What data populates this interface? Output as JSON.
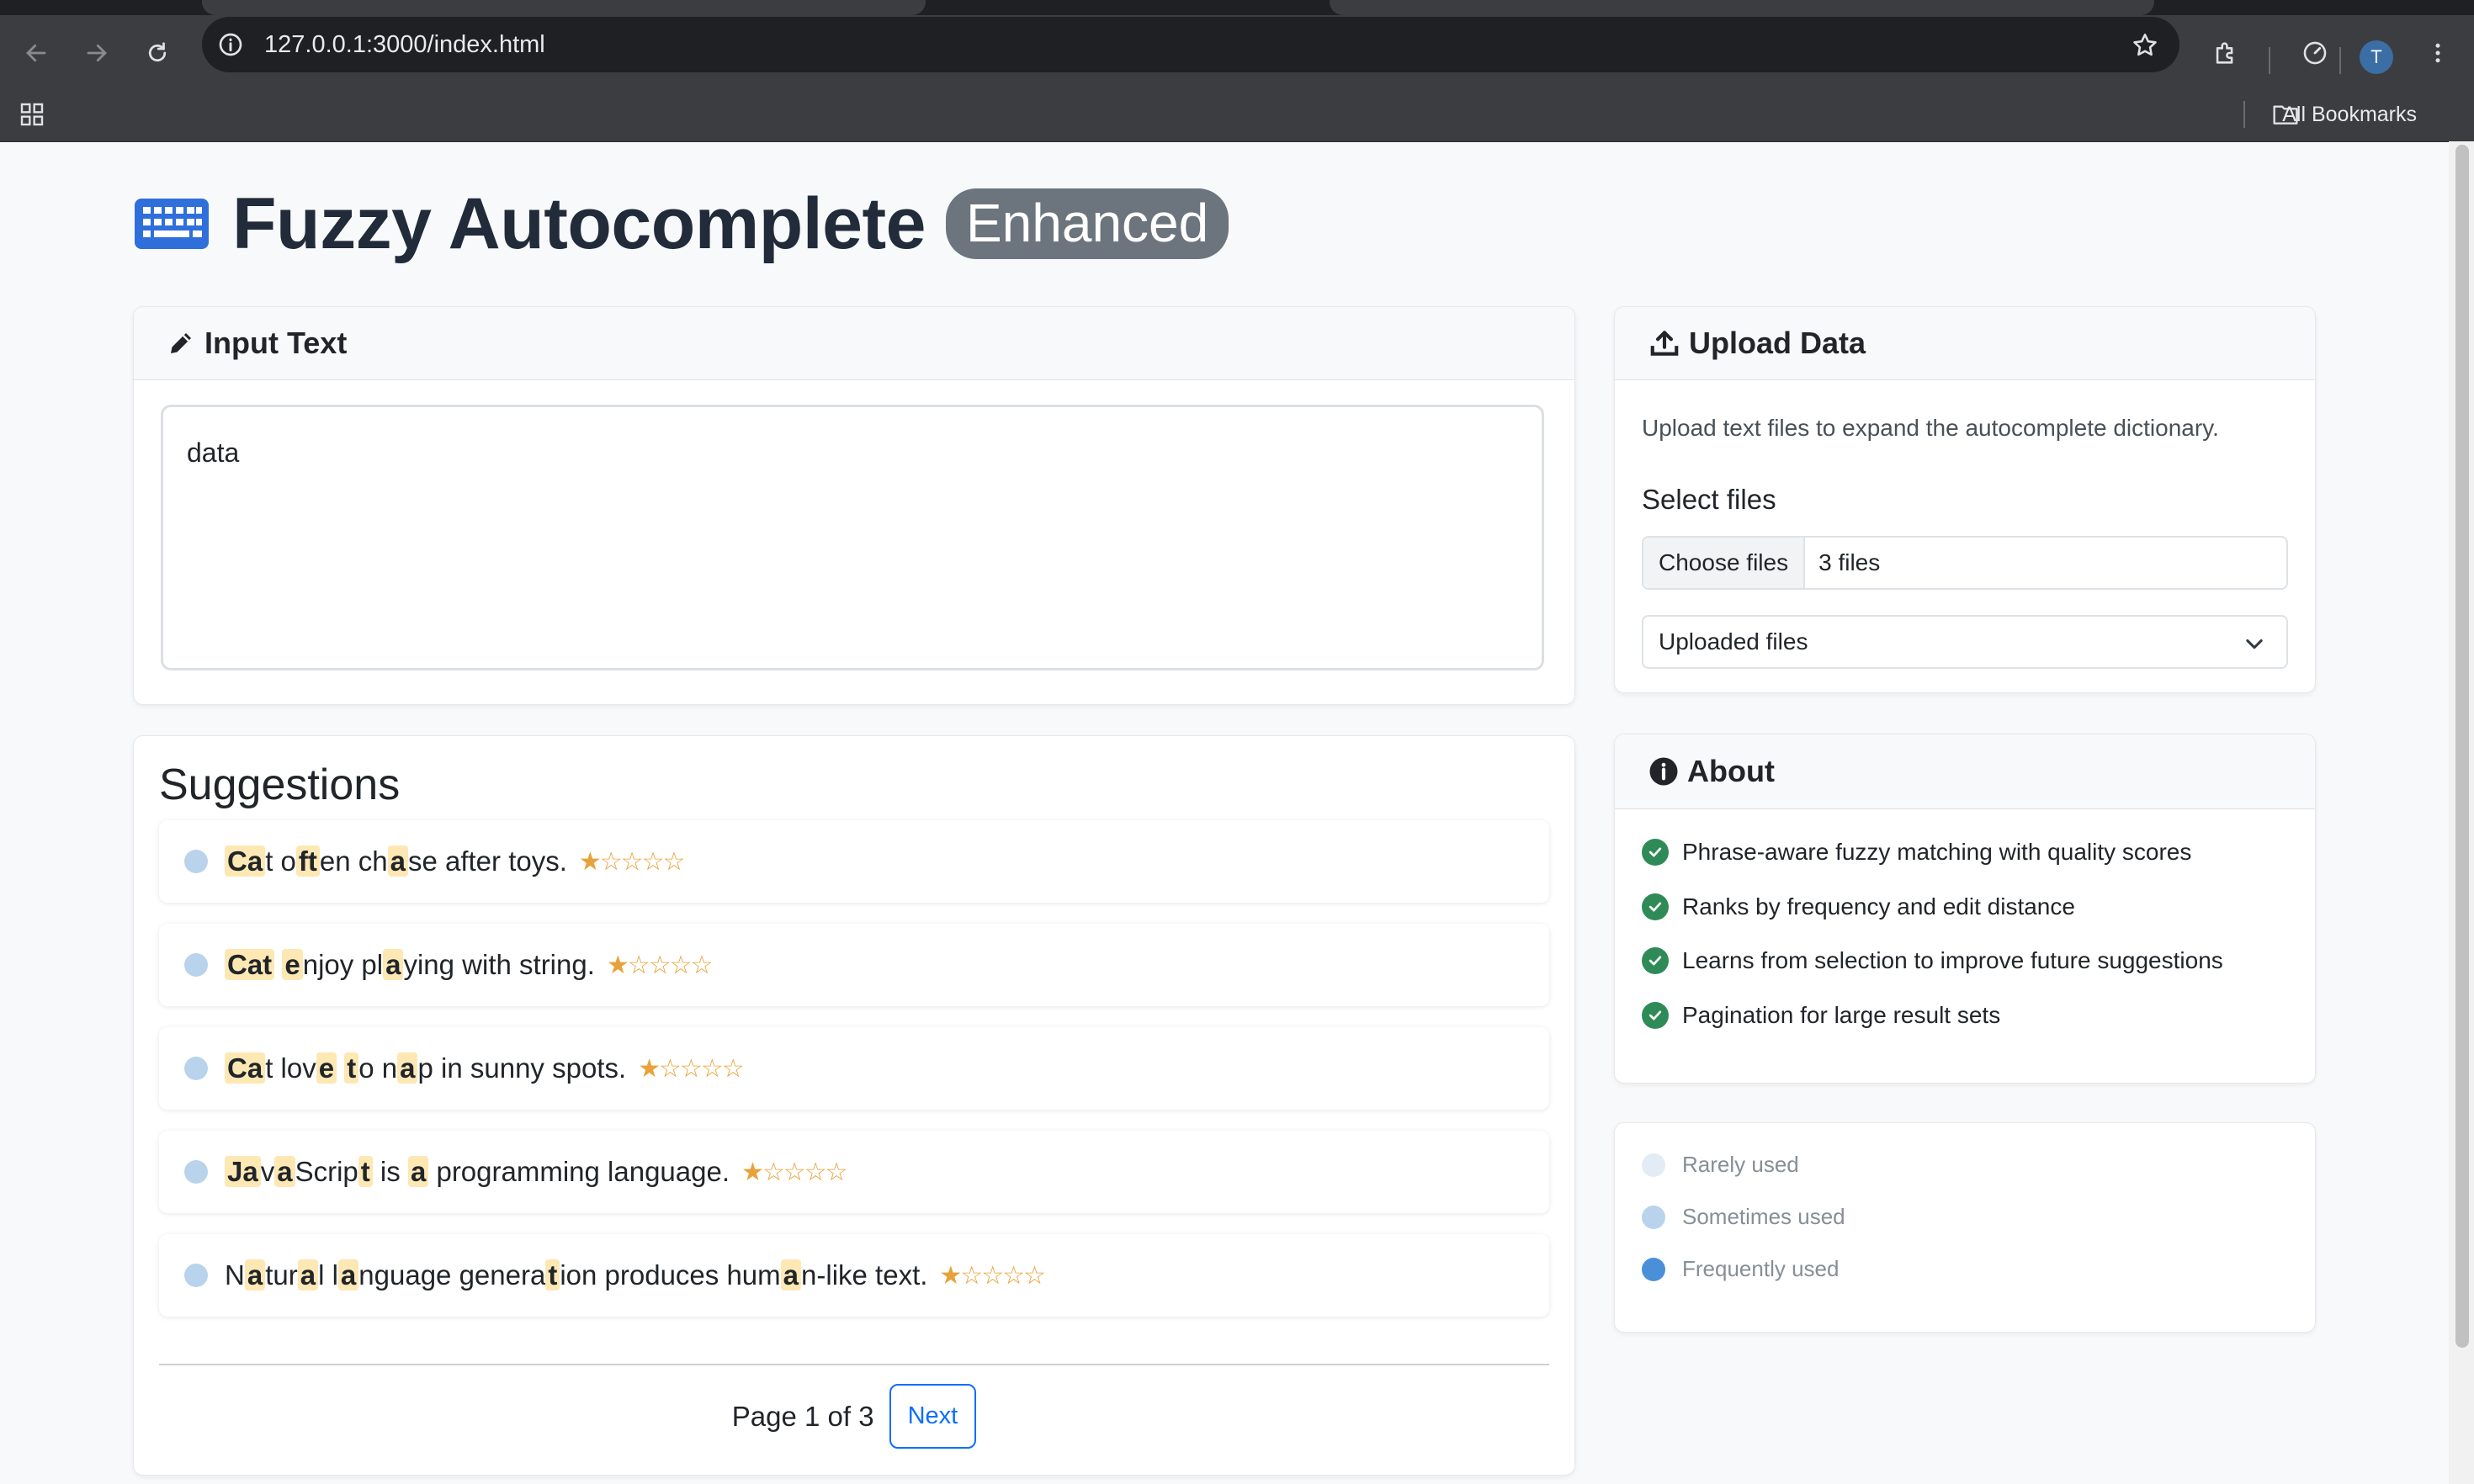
{
  "browser": {
    "url": "127.0.0.1:3000/index.html",
    "all_bookmarks": "All Bookmarks",
    "profile_initial": "T"
  },
  "page": {
    "title": "Fuzzy Autocomplete",
    "badge": "Enhanced"
  },
  "input_card": {
    "header": "Input Text",
    "value": "data"
  },
  "suggestions": {
    "title": "Suggestions",
    "items": [
      {
        "segments": [
          [
            "Ca",
            1
          ],
          [
            "t o",
            0
          ],
          [
            "ft",
            1
          ],
          [
            "en ch",
            0
          ],
          [
            "a",
            1
          ],
          [
            "se after toys.",
            0
          ]
        ],
        "stars": "★☆☆☆☆"
      },
      {
        "segments": [
          [
            "Cat",
            1
          ],
          [
            " ",
            0
          ],
          [
            "e",
            1
          ],
          [
            "njoy pl",
            0
          ],
          [
            "a",
            1
          ],
          [
            "ying with string.",
            0
          ]
        ],
        "stars": "★☆☆☆☆"
      },
      {
        "segments": [
          [
            "Ca",
            1
          ],
          [
            "t lov",
            0
          ],
          [
            "e",
            1
          ],
          [
            " ",
            0
          ],
          [
            "t",
            1
          ],
          [
            "o n",
            0
          ],
          [
            "a",
            1
          ],
          [
            "p in sunny spots.",
            0
          ]
        ],
        "stars": "★☆☆☆☆"
      },
      {
        "segments": [
          [
            "Ja",
            1
          ],
          [
            "v",
            0
          ],
          [
            "a",
            1
          ],
          [
            "Scrip",
            0
          ],
          [
            "t",
            1
          ],
          [
            " is ",
            0
          ],
          [
            "a",
            1
          ],
          [
            " programming language.",
            0
          ]
        ],
        "stars": "★☆☆☆☆"
      },
      {
        "segments": [
          [
            "N",
            0
          ],
          [
            "a",
            1
          ],
          [
            "tur",
            0
          ],
          [
            "a",
            1
          ],
          [
            "l l",
            0
          ],
          [
            "a",
            1
          ],
          [
            "nguage genera",
            0
          ],
          [
            "t",
            1
          ],
          [
            "ion produces hum",
            0
          ],
          [
            "a",
            1
          ],
          [
            "n-like text.",
            0
          ]
        ],
        "stars": "★☆☆☆☆"
      }
    ],
    "page_info": "Page 1 of 3",
    "next_label": "Next"
  },
  "upload": {
    "header": "Upload Data",
    "description": "Upload text files to expand the autocomplete dictionary.",
    "select_label": "Select files",
    "choose_button": "Choose files",
    "file_status": "3 files",
    "dropdown_value": "Uploaded files"
  },
  "about": {
    "header": "About",
    "features": [
      "Phrase-aware fuzzy matching with quality scores",
      "Ranks by frequency and edit distance",
      "Learns from selection to improve future suggestions",
      "Pagination for large result sets"
    ]
  },
  "legend": {
    "items": [
      {
        "label": "Rarely used",
        "color": "#e3ecf5"
      },
      {
        "label": "Sometimes used",
        "color": "#b9d3ec"
      },
      {
        "label": "Frequently used",
        "color": "#4a90d9"
      }
    ]
  },
  "colors": {
    "accent": "#0d6efd",
    "highlight": "#fde8b4",
    "check": "#2e8b57",
    "badge": "#6c757d"
  }
}
